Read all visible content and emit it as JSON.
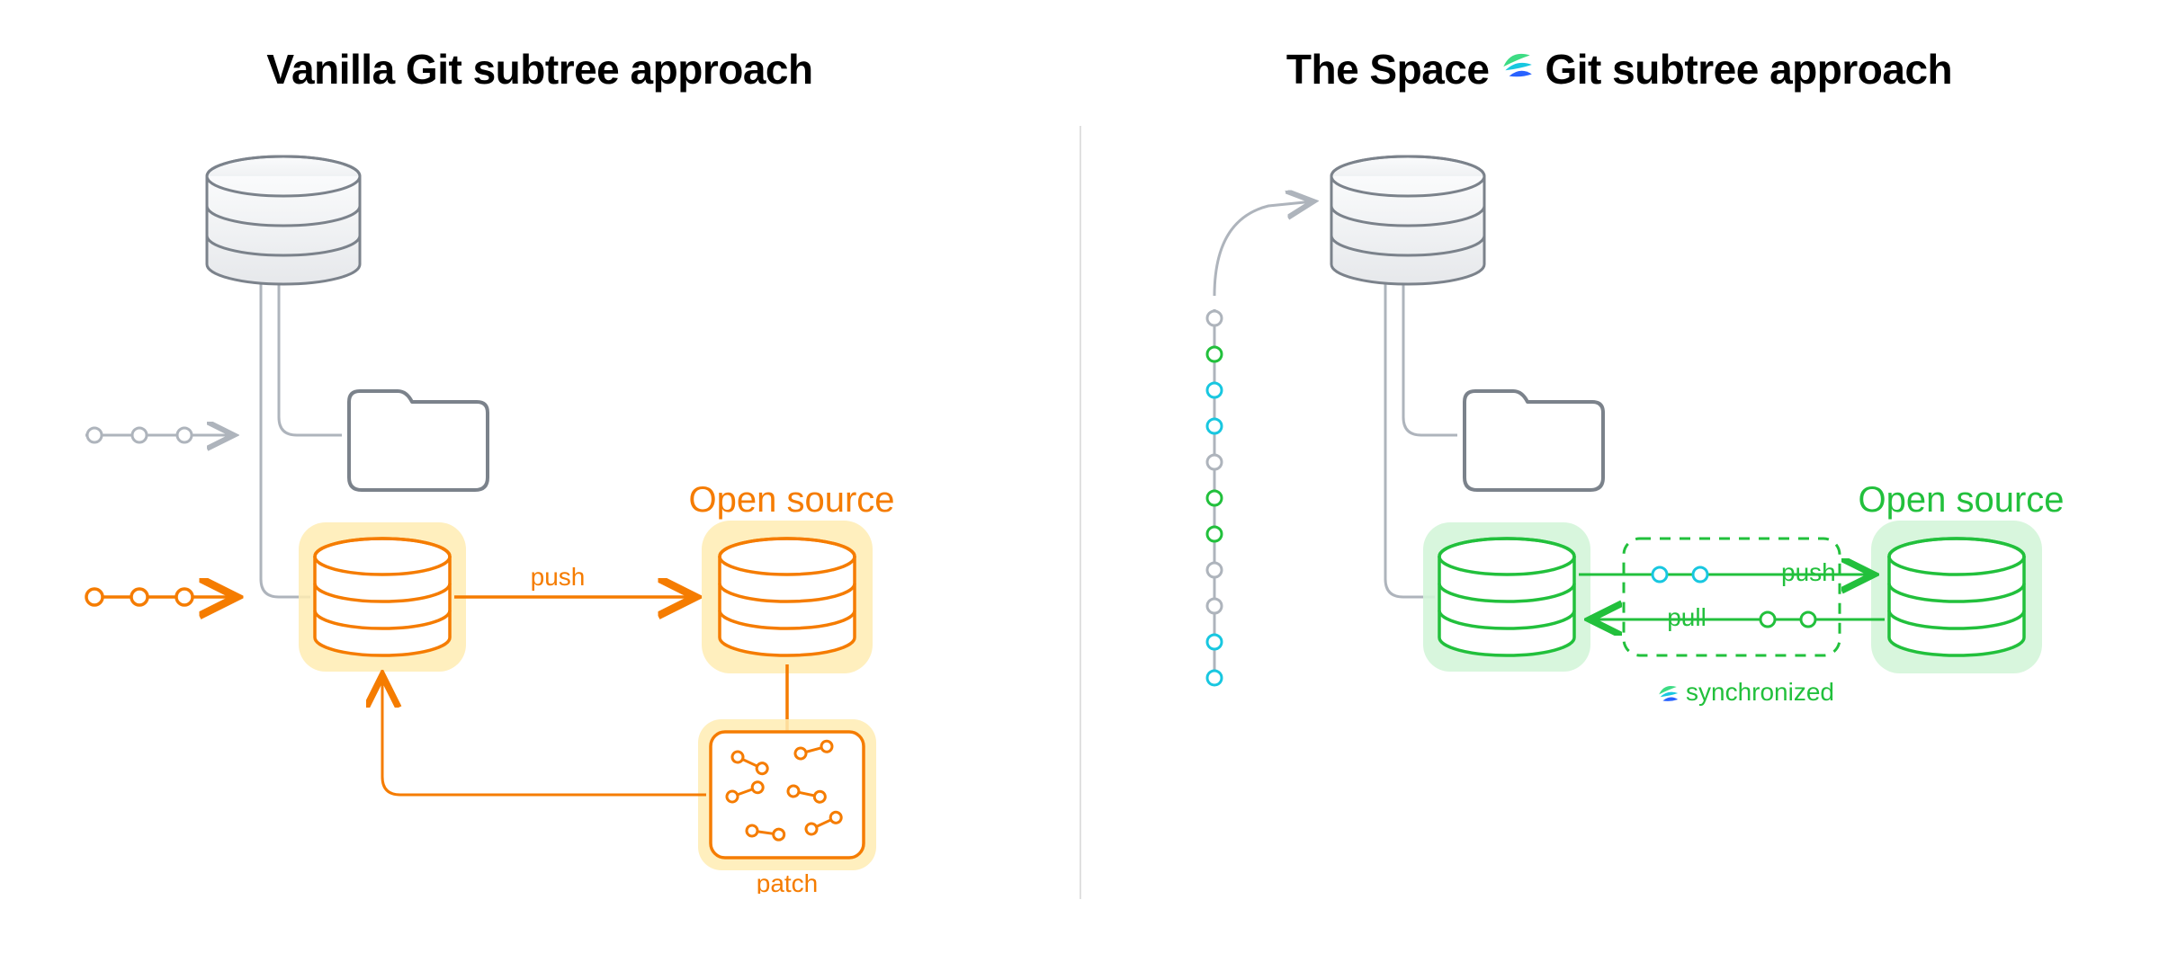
{
  "left": {
    "title": "Vanilla Git subtree approach",
    "open_source_label": "Open source",
    "push_label": "push",
    "patch_label": "patch"
  },
  "right": {
    "title_pre": "The Space",
    "title_post": "Git subtree approach",
    "open_source_label": "Open source",
    "push_label": "push",
    "pull_label": "pull",
    "sync_label": "synchronized"
  },
  "colors": {
    "orange": "#F57C00",
    "orange_glow": "#FFECB3",
    "green": "#22C03C",
    "green_glow": "#D4F5D9",
    "gray_line": "#AEB4BC",
    "gray_fill": "#F3F4F6",
    "gray_stroke": "#7B828B",
    "cyan": "#18C7E0"
  }
}
